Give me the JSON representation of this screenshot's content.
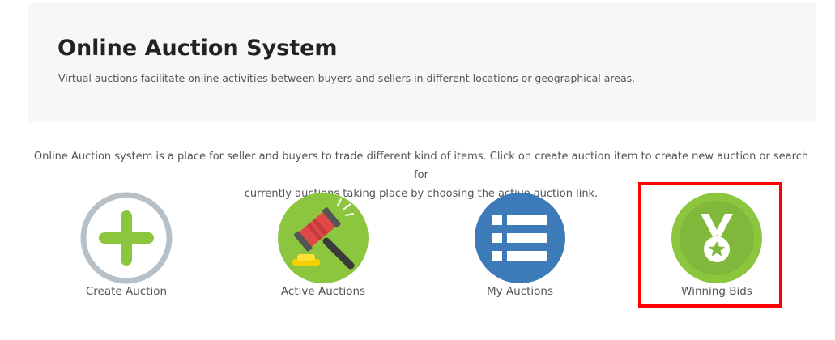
{
  "header": {
    "title": "Online Auction System",
    "subtitle": "Virtual auctions facilitate online activities between buyers and sellers in different locations or geographical areas."
  },
  "intro": {
    "line1": "Online Auction system is a place for seller and buyers to trade different kind of items. Click on create auction item to create new auction or search for",
    "line2": "currently auctions taking place by choosing the active auction link."
  },
  "tiles": [
    {
      "label": "Create Auction",
      "icon": "plus-circle-icon"
    },
    {
      "label": "Active Auctions",
      "icon": "gavel-icon"
    },
    {
      "label": "My Auctions",
      "icon": "list-icon"
    },
    {
      "label": "Winning Bids",
      "icon": "medal-icon"
    }
  ],
  "colors": {
    "green": "#8cc63f",
    "gray_ring": "#b7c0c7",
    "blue": "#3d7ab8",
    "highlight": "#ff0000"
  }
}
